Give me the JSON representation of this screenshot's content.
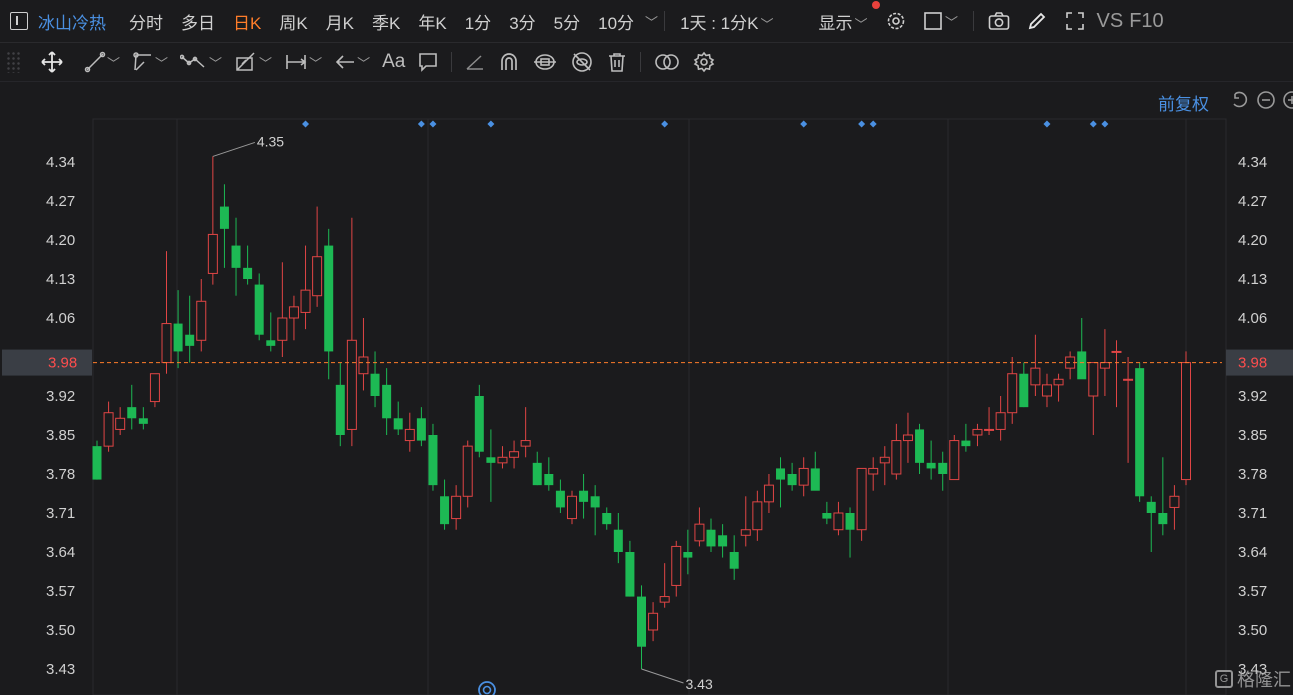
{
  "header": {
    "stock_name": "冰山冷热",
    "periods": [
      "分时",
      "多日",
      "日K",
      "周K",
      "月K",
      "季K",
      "年K",
      "1分",
      "3分",
      "5分",
      "10分"
    ],
    "active_period": "日K",
    "multi_period": "1天 : 1分K",
    "display_label": "显示",
    "vs_label": "VS",
    "f10_label": "F10"
  },
  "toolbar_icons": [
    "move-icon",
    "line-tool-icon",
    "ray-tool-icon",
    "polyline-tool-icon",
    "channel-tool-icon",
    "measure-tool-icon",
    "arrow-tool-icon",
    "text-tool-icon",
    "comment-tool-icon",
    "ruler-icon",
    "magnet-icon",
    "link-icon",
    "hide-icon",
    "delete-icon",
    "compare-icon",
    "settings-icon"
  ],
  "text_tool_label": "Aa",
  "adjust_label": "前复权",
  "watermark": "格隆汇",
  "colors": {
    "up": "#e04545",
    "down": "#1db954",
    "price_line": "#ff7d2a",
    "accent": "#4a90e2",
    "active_period": "#ff7d2a"
  },
  "chart_data": {
    "type": "candlestick",
    "ylim": [
      3.43,
      4.34
    ],
    "ticks": [
      "4.34",
      "4.27",
      "4.20",
      "4.13",
      "4.06",
      "3.98",
      "3.92",
      "3.85",
      "3.78",
      "3.71",
      "3.64",
      "3.57",
      "3.50",
      "3.43"
    ],
    "current_price": "3.98",
    "high_label": "4.35",
    "low_label": "3.43",
    "candles": [
      [
        3.83,
        3.84,
        3.77,
        3.77
      ],
      [
        3.83,
        3.91,
        3.82,
        3.89
      ],
      [
        3.86,
        3.9,
        3.85,
        3.88
      ],
      [
        3.9,
        3.94,
        3.86,
        3.88
      ],
      [
        3.88,
        3.9,
        3.86,
        3.87
      ],
      [
        3.91,
        3.96,
        3.9,
        3.96
      ],
      [
        3.98,
        4.18,
        3.96,
        4.05
      ],
      [
        4.05,
        4.11,
        3.97,
        4.0
      ],
      [
        4.03,
        4.1,
        3.98,
        4.01
      ],
      [
        4.02,
        4.13,
        4.0,
        4.09
      ],
      [
        4.14,
        4.35,
        4.12,
        4.21
      ],
      [
        4.26,
        4.3,
        4.15,
        4.22
      ],
      [
        4.19,
        4.24,
        4.1,
        4.15
      ],
      [
        4.15,
        4.19,
        4.12,
        4.13
      ],
      [
        4.12,
        4.14,
        4.02,
        4.03
      ],
      [
        4.02,
        4.07,
        4.0,
        4.01
      ],
      [
        4.02,
        4.16,
        3.99,
        4.06
      ],
      [
        4.06,
        4.1,
        4.02,
        4.08
      ],
      [
        4.07,
        4.19,
        4.04,
        4.11
      ],
      [
        4.1,
        4.26,
        4.08,
        4.17
      ],
      [
        4.19,
        4.22,
        3.95,
        4.0
      ],
      [
        3.94,
        3.98,
        3.83,
        3.85
      ],
      [
        3.86,
        4.24,
        3.83,
        4.02
      ],
      [
        3.96,
        4.06,
        3.93,
        3.99
      ],
      [
        3.96,
        4.0,
        3.9,
        3.92
      ],
      [
        3.94,
        3.97,
        3.85,
        3.88
      ],
      [
        3.88,
        3.91,
        3.85,
        3.86
      ],
      [
        3.84,
        3.89,
        3.82,
        3.86
      ],
      [
        3.88,
        3.9,
        3.83,
        3.84
      ],
      [
        3.85,
        3.87,
        3.75,
        3.76
      ],
      [
        3.74,
        3.77,
        3.68,
        3.69
      ],
      [
        3.7,
        3.76,
        3.68,
        3.74
      ],
      [
        3.74,
        3.84,
        3.72,
        3.83
      ],
      [
        3.92,
        3.94,
        3.81,
        3.82
      ],
      [
        3.81,
        3.86,
        3.73,
        3.8
      ],
      [
        3.8,
        3.83,
        3.79,
        3.81
      ],
      [
        3.81,
        3.84,
        3.79,
        3.82
      ],
      [
        3.83,
        3.9,
        3.81,
        3.84
      ],
      [
        3.8,
        3.82,
        3.76,
        3.76
      ],
      [
        3.78,
        3.81,
        3.75,
        3.76
      ],
      [
        3.75,
        3.77,
        3.71,
        3.72
      ],
      [
        3.7,
        3.75,
        3.69,
        3.74
      ],
      [
        3.75,
        3.78,
        3.7,
        3.73
      ],
      [
        3.74,
        3.76,
        3.67,
        3.72
      ],
      [
        3.71,
        3.72,
        3.68,
        3.69
      ],
      [
        3.68,
        3.71,
        3.62,
        3.64
      ],
      [
        3.64,
        3.66,
        3.56,
        3.56
      ],
      [
        3.56,
        3.58,
        3.43,
        3.47
      ],
      [
        3.5,
        3.55,
        3.48,
        3.53
      ],
      [
        3.55,
        3.62,
        3.54,
        3.56
      ],
      [
        3.58,
        3.66,
        3.56,
        3.65
      ],
      [
        3.64,
        3.68,
        3.6,
        3.63
      ],
      [
        3.66,
        3.72,
        3.65,
        3.69
      ],
      [
        3.68,
        3.7,
        3.64,
        3.65
      ],
      [
        3.67,
        3.69,
        3.63,
        3.65
      ],
      [
        3.64,
        3.67,
        3.59,
        3.61
      ],
      [
        3.67,
        3.74,
        3.65,
        3.68
      ],
      [
        3.68,
        3.75,
        3.66,
        3.73
      ],
      [
        3.73,
        3.78,
        3.71,
        3.76
      ],
      [
        3.79,
        3.81,
        3.72,
        3.77
      ],
      [
        3.78,
        3.8,
        3.75,
        3.76
      ],
      [
        3.76,
        3.81,
        3.74,
        3.79
      ],
      [
        3.79,
        3.82,
        3.76,
        3.75
      ],
      [
        3.71,
        3.73,
        3.69,
        3.7
      ],
      [
        3.68,
        3.73,
        3.67,
        3.71
      ],
      [
        3.71,
        3.72,
        3.63,
        3.68
      ],
      [
        3.68,
        3.79,
        3.66,
        3.79
      ],
      [
        3.78,
        3.81,
        3.75,
        3.79
      ],
      [
        3.8,
        3.83,
        3.76,
        3.81
      ],
      [
        3.78,
        3.87,
        3.77,
        3.84
      ],
      [
        3.84,
        3.89,
        3.8,
        3.85
      ],
      [
        3.86,
        3.87,
        3.78,
        3.8
      ],
      [
        3.8,
        3.84,
        3.77,
        3.79
      ],
      [
        3.8,
        3.82,
        3.75,
        3.78
      ],
      [
        3.77,
        3.85,
        3.77,
        3.84
      ],
      [
        3.84,
        3.87,
        3.82,
        3.83
      ],
      [
        3.85,
        3.87,
        3.83,
        3.86
      ],
      [
        3.86,
        3.9,
        3.85,
        3.86
      ],
      [
        3.86,
        3.92,
        3.84,
        3.89
      ],
      [
        3.89,
        3.99,
        3.87,
        3.96
      ],
      [
        3.96,
        3.98,
        3.9,
        3.9
      ],
      [
        3.94,
        4.03,
        3.92,
        3.97
      ],
      [
        3.92,
        3.96,
        3.9,
        3.94
      ],
      [
        3.94,
        3.96,
        3.91,
        3.95
      ],
      [
        3.97,
        4.0,
        3.95,
        3.99
      ],
      [
        4.0,
        4.06,
        3.96,
        3.95
      ],
      [
        3.92,
        3.97,
        3.85,
        3.98
      ],
      [
        3.97,
        4.04,
        3.92,
        3.98
      ],
      [
        4.0,
        4.02,
        3.9,
        4.0
      ],
      [
        3.95,
        3.99,
        3.8,
        3.95
      ],
      [
        3.97,
        3.98,
        3.73,
        3.74
      ],
      [
        3.73,
        3.74,
        3.64,
        3.71
      ],
      [
        3.71,
        3.81,
        3.67,
        3.69
      ],
      [
        3.72,
        3.76,
        3.68,
        3.74
      ],
      [
        3.77,
        4.0,
        3.76,
        3.98
      ]
    ],
    "event_markers_at": [
      18,
      28,
      29,
      34,
      49,
      61,
      66,
      67,
      82,
      86,
      87
    ]
  }
}
